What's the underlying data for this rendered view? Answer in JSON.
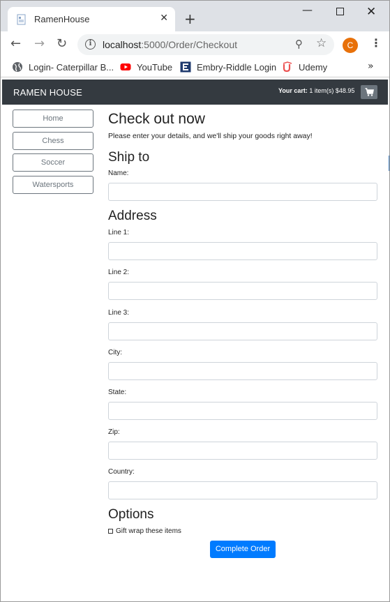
{
  "browser": {
    "tab_title": "RamenHouse",
    "tab_close": "✕",
    "new_tab": "+",
    "url_host": "localhost",
    "url_path": ":5000/Order/Checkout",
    "profile_initial": "C",
    "profile_color": "#e8710a",
    "bookmarks": [
      {
        "label": "Login- Caterpillar B...",
        "icon": "globe-icon"
      },
      {
        "label": "YouTube",
        "icon": "youtube-icon"
      },
      {
        "label": "Embry-Riddle Login",
        "icon": "erau-icon"
      },
      {
        "label": "Udemy",
        "icon": "udemy-icon"
      }
    ],
    "bookmarks_more": "»"
  },
  "navbar": {
    "brand": "RAMEN HOUSE",
    "cart_label": "Your cart:",
    "cart_detail": "1 item(s) $48.95"
  },
  "sidebar": {
    "categories": [
      "Home",
      "Chess",
      "Soccer",
      "Watersports"
    ]
  },
  "checkout": {
    "title": "Check out now",
    "lead": "Please enter your details, and we'll ship your goods right away!",
    "ship_to_heading": "Ship to",
    "name_label": "Name:",
    "address_heading": "Address",
    "line1_label": "Line 1:",
    "line2_label": "Line 2:",
    "line3_label": "Line 3:",
    "city_label": "City:",
    "state_label": "State:",
    "zip_label": "Zip:",
    "country_label": "Country:",
    "options_heading": "Options",
    "giftwrap_label": "Gift wrap these items",
    "submit_label": "Complete Order"
  },
  "colors": {
    "navbar_bg": "#343a40",
    "primary": "#007bff",
    "secondary": "#6c757d"
  }
}
